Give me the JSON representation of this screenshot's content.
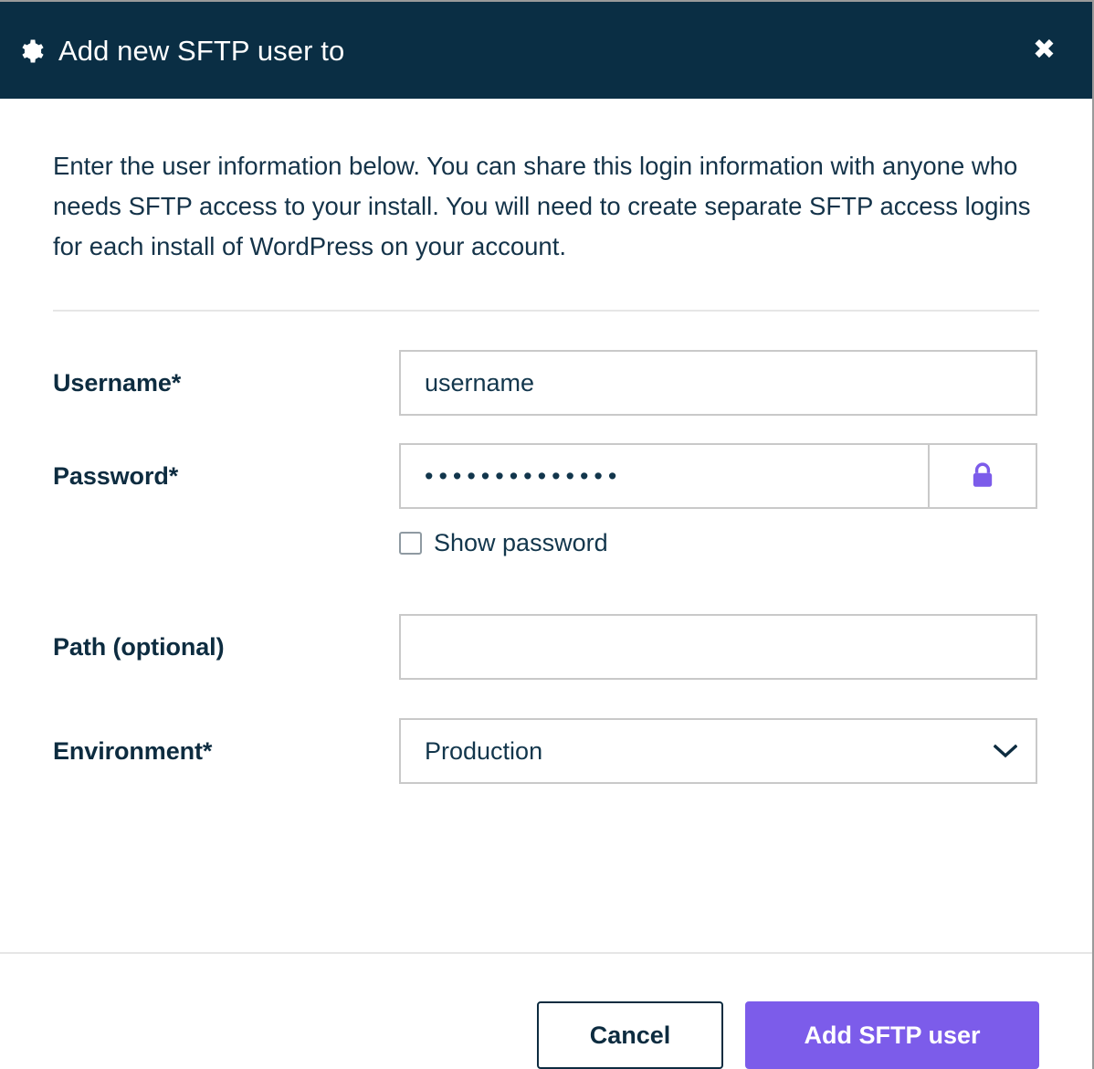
{
  "header": {
    "icon": "gear-icon",
    "title": "Add new SFTP user to",
    "close_label": "✖",
    "background_color": "#0a2e44",
    "text_color": "#ffffff"
  },
  "body": {
    "intro": "Enter the user information below. You can share this login information with anyone who needs SFTP access to your install. You will need to create separate SFTP access logins for each install of WordPress on your account."
  },
  "form": {
    "username": {
      "label": "Username*",
      "value": "username",
      "placeholder": "username"
    },
    "password": {
      "label": "Password*",
      "value": "••••••••••••••",
      "masked_character_count": 14,
      "generate_icon": "lock-icon",
      "generate_icon_color": "#7c5cea"
    },
    "show_password": {
      "label": "Show password",
      "checked": false
    },
    "path": {
      "label": "Path (optional)",
      "value": "",
      "placeholder": ""
    },
    "environment": {
      "label": "Environment*",
      "value": "Production",
      "options": [
        "Production"
      ],
      "chevron_icon": "chevron-down-icon"
    }
  },
  "footer": {
    "cancel_label": "Cancel",
    "submit_label": "Add SFTP user",
    "primary_color": "#7c5cea"
  }
}
